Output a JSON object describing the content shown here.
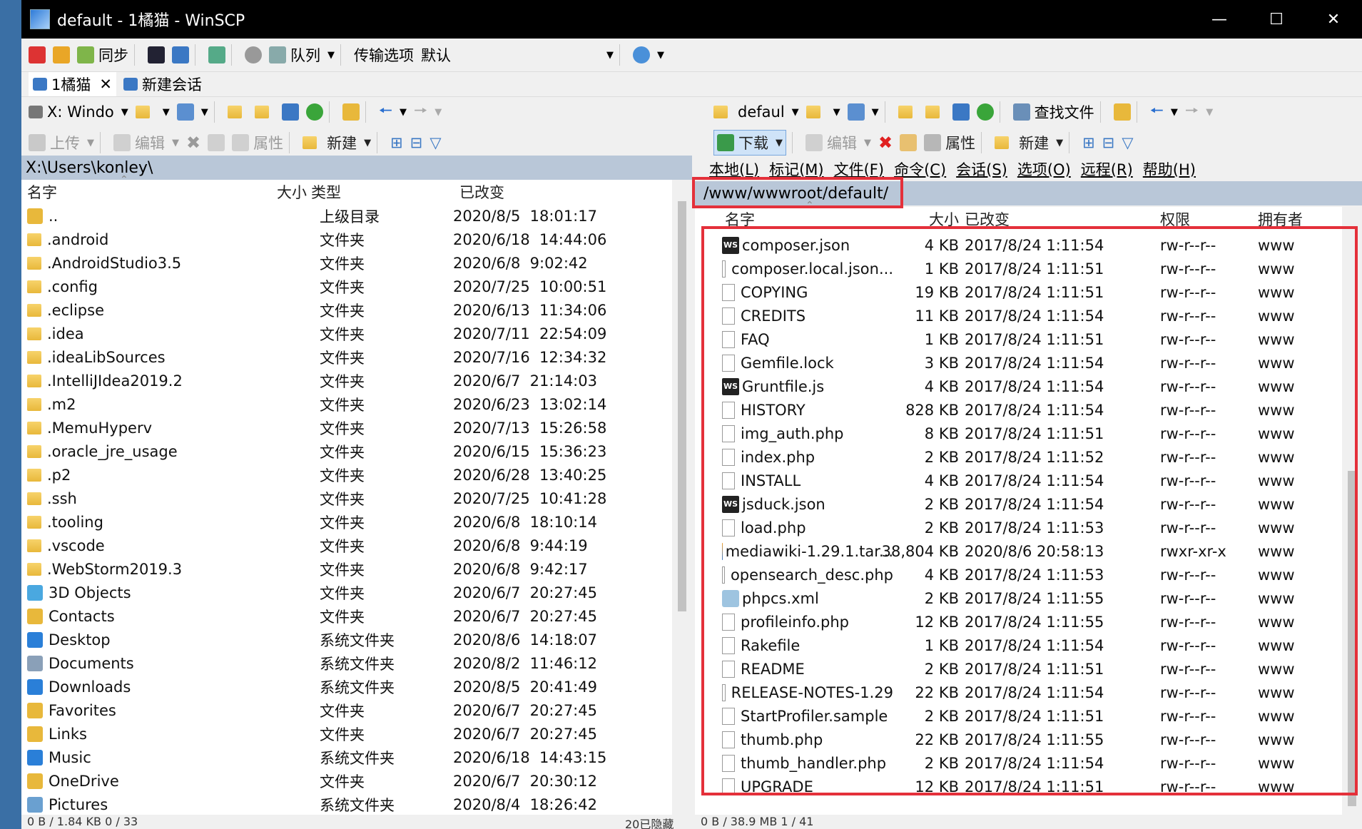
{
  "window": {
    "title": "default - 1橘猫 - WinSCP"
  },
  "toolbar1": {
    "sync": "同步",
    "queue": "队列",
    "transfer_options_label": "传输选项",
    "transfer_options_value": "默认"
  },
  "tabs": {
    "session": "1橘猫",
    "new_session": "新建会话"
  },
  "left": {
    "drive": "X: Windo",
    "upload": "上传",
    "edit": "编辑",
    "properties": "属性",
    "new": "新建",
    "path": "X:\\Users\\konley\\",
    "columns": {
      "name": "名字",
      "size": "大小",
      "type": "类型",
      "changed": "已改变"
    },
    "rows": [
      {
        "name": "..",
        "type": "上级目录",
        "changed": "2020/8/5  18:01:17"
      },
      {
        "name": ".android",
        "type": "文件夹",
        "changed": "2020/6/18  14:44:06"
      },
      {
        "name": ".AndroidStudio3.5",
        "type": "文件夹",
        "changed": "2020/6/8  9:02:42"
      },
      {
        "name": ".config",
        "type": "文件夹",
        "changed": "2020/7/25  10:00:51"
      },
      {
        "name": ".eclipse",
        "type": "文件夹",
        "changed": "2020/6/13  11:34:06"
      },
      {
        "name": ".idea",
        "type": "文件夹",
        "changed": "2020/7/11  22:54:09"
      },
      {
        "name": ".ideaLibSources",
        "type": "文件夹",
        "changed": "2020/7/16  12:34:32"
      },
      {
        "name": ".IntelliJIdea2019.2",
        "type": "文件夹",
        "changed": "2020/6/7  21:14:03"
      },
      {
        "name": ".m2",
        "type": "文件夹",
        "changed": "2020/6/23  13:02:14"
      },
      {
        "name": ".MemuHyperv",
        "type": "文件夹",
        "changed": "2020/7/13  15:26:58"
      },
      {
        "name": ".oracle_jre_usage",
        "type": "文件夹",
        "changed": "2020/6/15  15:36:23"
      },
      {
        "name": ".p2",
        "type": "文件夹",
        "changed": "2020/6/28  13:40:25"
      },
      {
        "name": ".ssh",
        "type": "文件夹",
        "changed": "2020/7/25  10:41:28"
      },
      {
        "name": ".tooling",
        "type": "文件夹",
        "changed": "2020/6/8  18:10:14"
      },
      {
        "name": ".vscode",
        "type": "文件夹",
        "changed": "2020/6/8  9:44:19"
      },
      {
        "name": ".WebStorm2019.3",
        "type": "文件夹",
        "changed": "2020/6/8  9:42:17"
      },
      {
        "name": "3D Objects",
        "type": "文件夹",
        "changed": "2020/6/7  20:27:45"
      },
      {
        "name": "Contacts",
        "type": "文件夹",
        "changed": "2020/6/7  20:27:45"
      },
      {
        "name": "Desktop",
        "type": "系统文件夹",
        "changed": "2020/8/6  14:18:07"
      },
      {
        "name": "Documents",
        "type": "系统文件夹",
        "changed": "2020/8/2  11:46:12"
      },
      {
        "name": "Downloads",
        "type": "系统文件夹",
        "changed": "2020/8/5  20:41:49"
      },
      {
        "name": "Favorites",
        "type": "文件夹",
        "changed": "2020/6/7  20:27:45"
      },
      {
        "name": "Links",
        "type": "文件夹",
        "changed": "2020/6/7  20:27:45"
      },
      {
        "name": "Music",
        "type": "系统文件夹",
        "changed": "2020/6/18  14:43:15"
      },
      {
        "name": "OneDrive",
        "type": "文件夹",
        "changed": "2020/6/7  20:30:12"
      },
      {
        "name": "Pictures",
        "type": "系统文件夹",
        "changed": "2020/8/4  18:26:42"
      }
    ],
    "status": "0 B / 1.84 KB     0 / 33",
    "hidden": "20已隐藏"
  },
  "right": {
    "drive": "defaul",
    "find_files": "查找文件",
    "download": "下载",
    "edit": "编辑",
    "properties": "属性",
    "new": "新建",
    "menu": [
      "本地(L)",
      "标记(M)",
      "文件(F)",
      "命令(C)",
      "会话(S)",
      "选项(O)",
      "远程(R)",
      "帮助(H)"
    ],
    "path": "/www/wwwroot/default/",
    "columns": {
      "name": "名字",
      "size": "大小",
      "changed": "已改变",
      "rights": "权限",
      "owner": "拥有者"
    },
    "rows": [
      {
        "name": "composer.json",
        "size": "4 KB",
        "changed": "2017/8/24 1:11:54",
        "rights": "rw-r--r--",
        "owner": "www",
        "icon": "ws"
      },
      {
        "name": "composer.local.json...",
        "size": "1 KB",
        "changed": "2017/8/24 1:11:51",
        "rights": "rw-r--r--",
        "owner": "www",
        "icon": "file"
      },
      {
        "name": "COPYING",
        "size": "19 KB",
        "changed": "2017/8/24 1:11:51",
        "rights": "rw-r--r--",
        "owner": "www",
        "icon": "file"
      },
      {
        "name": "CREDITS",
        "size": "11 KB",
        "changed": "2017/8/24 1:11:54",
        "rights": "rw-r--r--",
        "owner": "www",
        "icon": "file"
      },
      {
        "name": "FAQ",
        "size": "1 KB",
        "changed": "2017/8/24 1:11:51",
        "rights": "rw-r--r--",
        "owner": "www",
        "icon": "file"
      },
      {
        "name": "Gemfile.lock",
        "size": "3 KB",
        "changed": "2017/8/24 1:11:54",
        "rights": "rw-r--r--",
        "owner": "www",
        "icon": "file"
      },
      {
        "name": "Gruntfile.js",
        "size": "4 KB",
        "changed": "2017/8/24 1:11:54",
        "rights": "rw-r--r--",
        "owner": "www",
        "icon": "ws"
      },
      {
        "name": "HISTORY",
        "size": "828 KB",
        "changed": "2017/8/24 1:11:54",
        "rights": "rw-r--r--",
        "owner": "www",
        "icon": "file"
      },
      {
        "name": "img_auth.php",
        "size": "8 KB",
        "changed": "2017/8/24 1:11:51",
        "rights": "rw-r--r--",
        "owner": "www",
        "icon": "file"
      },
      {
        "name": "index.php",
        "size": "2 KB",
        "changed": "2017/8/24 1:11:52",
        "rights": "rw-r--r--",
        "owner": "www",
        "icon": "file"
      },
      {
        "name": "INSTALL",
        "size": "4 KB",
        "changed": "2017/8/24 1:11:54",
        "rights": "rw-r--r--",
        "owner": "www",
        "icon": "file"
      },
      {
        "name": "jsduck.json",
        "size": "2 KB",
        "changed": "2017/8/24 1:11:54",
        "rights": "rw-r--r--",
        "owner": "www",
        "icon": "ws"
      },
      {
        "name": "load.php",
        "size": "2 KB",
        "changed": "2017/8/24 1:11:53",
        "rights": "rw-r--r--",
        "owner": "www",
        "icon": "file"
      },
      {
        "name": "mediawiki-1.29.1.tar...",
        "size": "38,804 KB",
        "changed": "2020/8/6 20:58:13",
        "rights": "rwxr-xr-x",
        "owner": "www",
        "icon": "archive"
      },
      {
        "name": "opensearch_desc.php",
        "size": "4 KB",
        "changed": "2017/8/24 1:11:53",
        "rights": "rw-r--r--",
        "owner": "www",
        "icon": "file"
      },
      {
        "name": "phpcs.xml",
        "size": "2 KB",
        "changed": "2017/8/24 1:11:55",
        "rights": "rw-r--r--",
        "owner": "www",
        "icon": "xml"
      },
      {
        "name": "profileinfo.php",
        "size": "12 KB",
        "changed": "2017/8/24 1:11:55",
        "rights": "rw-r--r--",
        "owner": "www",
        "icon": "file"
      },
      {
        "name": "Rakefile",
        "size": "1 KB",
        "changed": "2017/8/24 1:11:54",
        "rights": "rw-r--r--",
        "owner": "www",
        "icon": "file"
      },
      {
        "name": "README",
        "size": "2 KB",
        "changed": "2017/8/24 1:11:51",
        "rights": "rw-r--r--",
        "owner": "www",
        "icon": "file"
      },
      {
        "name": "RELEASE-NOTES-1.29",
        "size": "22 KB",
        "changed": "2017/8/24 1:11:54",
        "rights": "rw-r--r--",
        "owner": "www",
        "icon": "file"
      },
      {
        "name": "StartProfiler.sample",
        "size": "2 KB",
        "changed": "2017/8/24 1:11:51",
        "rights": "rw-r--r--",
        "owner": "www",
        "icon": "file"
      },
      {
        "name": "thumb.php",
        "size": "22 KB",
        "changed": "2017/8/24 1:11:55",
        "rights": "rw-r--r--",
        "owner": "www",
        "icon": "file"
      },
      {
        "name": "thumb_handler.php",
        "size": "2 KB",
        "changed": "2017/8/24 1:11:54",
        "rights": "rw-r--r--",
        "owner": "www",
        "icon": "file"
      },
      {
        "name": "UPGRADE",
        "size": "12 KB",
        "changed": "2017/8/24 1:11:51",
        "rights": "rw-r--r--",
        "owner": "www",
        "icon": "file"
      }
    ],
    "status": "0 B / 38.9 MB     1 / 41"
  },
  "colors": {
    "highlight": "#e4303a",
    "titlebar": "#000000",
    "path_bar": "#b9c7d8"
  }
}
